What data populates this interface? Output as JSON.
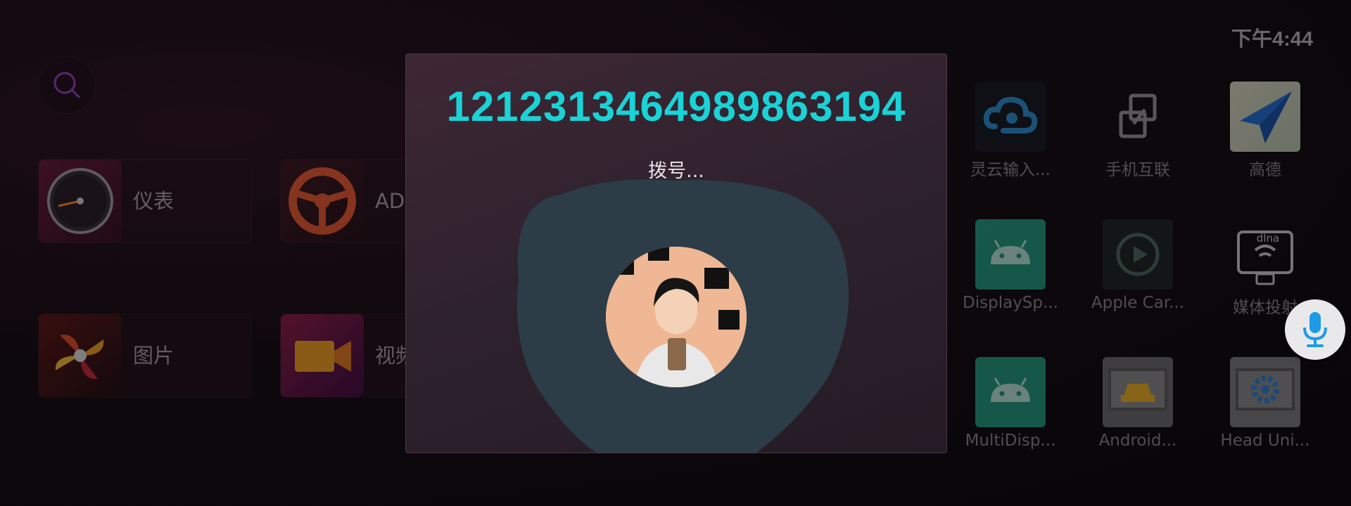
{
  "status_bar": {
    "time": "下午4:44"
  },
  "home": {
    "search_icon": "search-icon",
    "tiles": [
      {
        "label": "仪表",
        "icon": "gauge-icon"
      },
      {
        "label": "AD",
        "icon": "steering-wheel-icon"
      },
      {
        "label": "图片",
        "icon": "pinwheel-icon"
      },
      {
        "label": "视频",
        "icon": "video-camera-icon"
      }
    ],
    "apps": [
      {
        "label": "灵云输入...",
        "icon": "cloud-input-icon"
      },
      {
        "label": "手机互联",
        "icon": "phone-link-icon"
      },
      {
        "label": "高德",
        "icon": "amap-icon"
      },
      {
        "label": "DisplaySp...",
        "icon": "android-icon"
      },
      {
        "label": "Apple Car...",
        "icon": "carplay-icon"
      },
      {
        "label": "媒体投射",
        "icon": "dlna-cast-icon"
      },
      {
        "label": "MultiDisp...",
        "icon": "android-icon"
      },
      {
        "label": "Android...",
        "icon": "android-auto-icon"
      },
      {
        "label": "Head Uni...",
        "icon": "settings-gear-icon"
      }
    ],
    "dlna_text": "dlna",
    "voice_icon": "microphone-icon"
  },
  "call_dialog": {
    "number": "1212313464989863194",
    "status": "拨号...",
    "avatar": "contact-avatar"
  },
  "colors": {
    "accent_number": "#19d3d7",
    "dialog_bg": "#3e2734",
    "blob": "#2c3d48",
    "mic_blue": "#1e9be6"
  }
}
